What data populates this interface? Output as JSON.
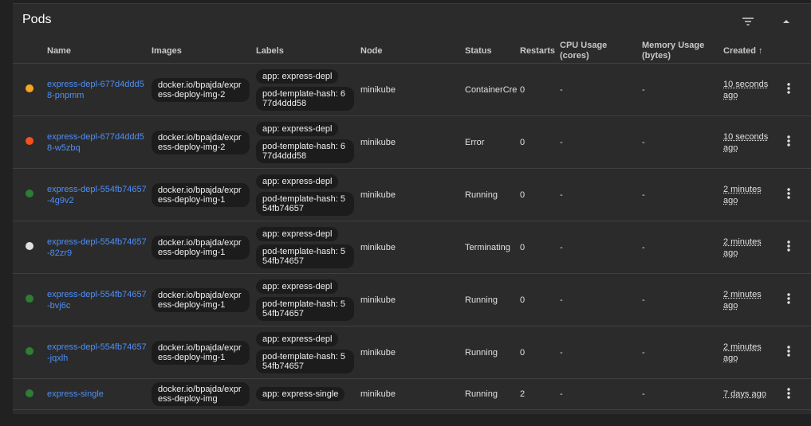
{
  "title": "Pods",
  "icons": {
    "filter": "filter-icon",
    "collapse": "collapse-icon",
    "menu": "more-vert-icon",
    "sort": "arrow-up-icon"
  },
  "columns": {
    "name": "Name",
    "images": "Images",
    "labels": "Labels",
    "node": "Node",
    "status": "Status",
    "restarts": "Restarts",
    "cpu": "CPU Usage (cores)",
    "memory": "Memory Usage (bytes)",
    "created": "Created",
    "sort_arrow": "↑"
  },
  "colors": {
    "pending": "#f5a623",
    "error": "#f4511e",
    "running": "#2e7d32",
    "terminating": "#e0e0e0",
    "link": "#4f8ff7"
  },
  "rows": [
    {
      "status_color": "#f5a623",
      "name": "express-depl-677d4ddd58-pnpmm",
      "image": "docker.io/bpajda/express-deploy-img-2",
      "label_app": "app: express-depl",
      "label_hash": "pod-template-hash: 677d4ddd58",
      "node": "minikube",
      "status": "ContainerCre",
      "restarts": "0",
      "cpu": "-",
      "memory": "-",
      "created": "10 seconds ago"
    },
    {
      "status_color": "#f4511e",
      "name": "express-depl-677d4ddd58-w5zbq",
      "image": "docker.io/bpajda/express-deploy-img-2",
      "label_app": "app: express-depl",
      "label_hash": "pod-template-hash: 677d4ddd58",
      "node": "minikube",
      "status": "Error",
      "restarts": "0",
      "cpu": "-",
      "memory": "-",
      "created": "10 seconds ago"
    },
    {
      "status_color": "#2e7d32",
      "name": "express-depl-554fb74657-4g9v2",
      "image": "docker.io/bpajda/express-deploy-img-1",
      "label_app": "app: express-depl",
      "label_hash": "pod-template-hash: 554fb74657",
      "node": "minikube",
      "status": "Running",
      "restarts": "0",
      "cpu": "-",
      "memory": "-",
      "created": "2 minutes ago"
    },
    {
      "status_color": "#e0e0e0",
      "name": "express-depl-554fb74657-82zr9",
      "image": "docker.io/bpajda/express-deploy-img-1",
      "label_app": "app: express-depl",
      "label_hash": "pod-template-hash: 554fb74657",
      "node": "minikube",
      "status": "Terminating",
      "restarts": "0",
      "cpu": "-",
      "memory": "-",
      "created": "2 minutes ago"
    },
    {
      "status_color": "#2e7d32",
      "name": "express-depl-554fb74657-bvj6c",
      "image": "docker.io/bpajda/express-deploy-img-1",
      "label_app": "app: express-depl",
      "label_hash": "pod-template-hash: 554fb74657",
      "node": "minikube",
      "status": "Running",
      "restarts": "0",
      "cpu": "-",
      "memory": "-",
      "created": "2 minutes ago"
    },
    {
      "status_color": "#2e7d32",
      "name": "express-depl-554fb74657-jqxlh",
      "image": "docker.io/bpajda/express-deploy-img-1",
      "label_app": "app: express-depl",
      "label_hash": "pod-template-hash: 554fb74657",
      "node": "minikube",
      "status": "Running",
      "restarts": "0",
      "cpu": "-",
      "memory": "-",
      "created": "2 minutes ago"
    },
    {
      "status_color": "#2e7d32",
      "name": "express-single",
      "image": "docker.io/bpajda/express-deploy-img",
      "label_app": "app: express-single",
      "label_hash": "",
      "node": "minikube",
      "status": "Running",
      "restarts": "2",
      "cpu": "-",
      "memory": "-",
      "created": "7 days ago"
    }
  ]
}
